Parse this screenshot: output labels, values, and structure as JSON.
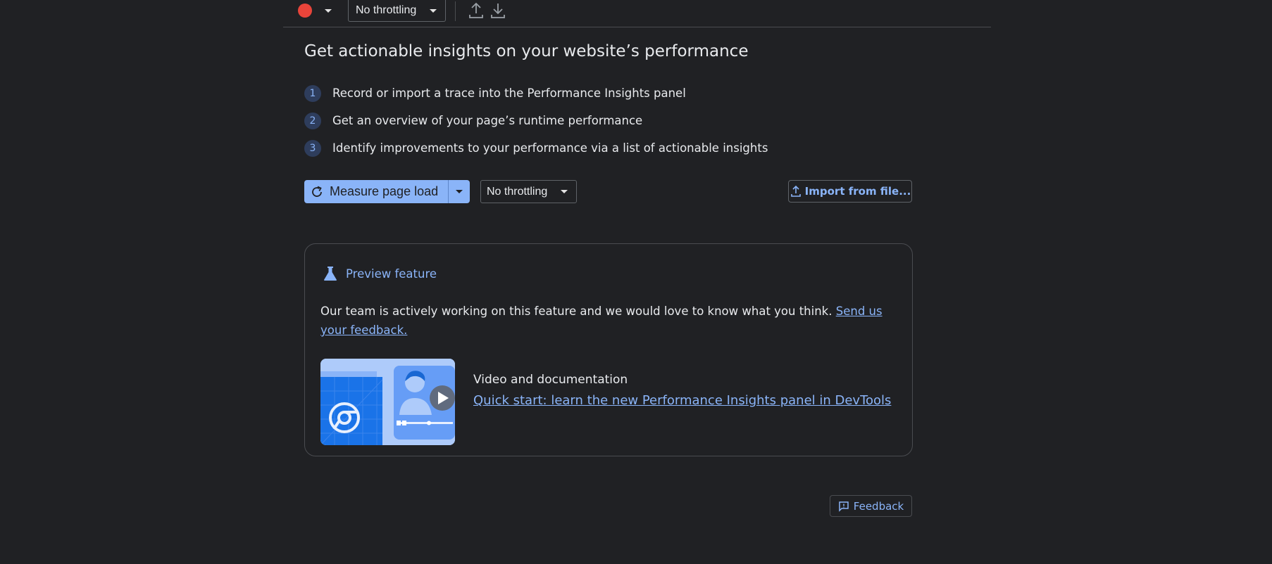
{
  "toolbar": {
    "record_icon": "record-icon",
    "throttling_value": "No throttling",
    "upload_icon": "upload-icon",
    "download_icon": "download-icon"
  },
  "main": {
    "title": "Get actionable insights on your website’s performance",
    "steps": [
      {
        "number": "1",
        "text": "Record or import a trace into the Performance Insights panel"
      },
      {
        "number": "2",
        "text": "Get an overview of your page’s runtime performance"
      },
      {
        "number": "3",
        "text": "Identify improvements to your performance via a list of actionable insights"
      }
    ],
    "measure_button_label": "Measure page load",
    "throttling_value": "No throttling",
    "import_button_label": "Import from file..."
  },
  "preview_card": {
    "label": "Preview feature",
    "body_text": "Our team is actively working on this feature and we would love to know what you think. ",
    "feedback_link": "Send us your feedback.",
    "video_title": "Video and documentation",
    "video_link": "Quick start: learn the new Performance Insights panel in DevTools"
  },
  "footer": {
    "feedback_button_label": "Feedback"
  },
  "colors": {
    "background": "#202124",
    "accent": "#8ab4f8",
    "record": "#e8443a"
  }
}
